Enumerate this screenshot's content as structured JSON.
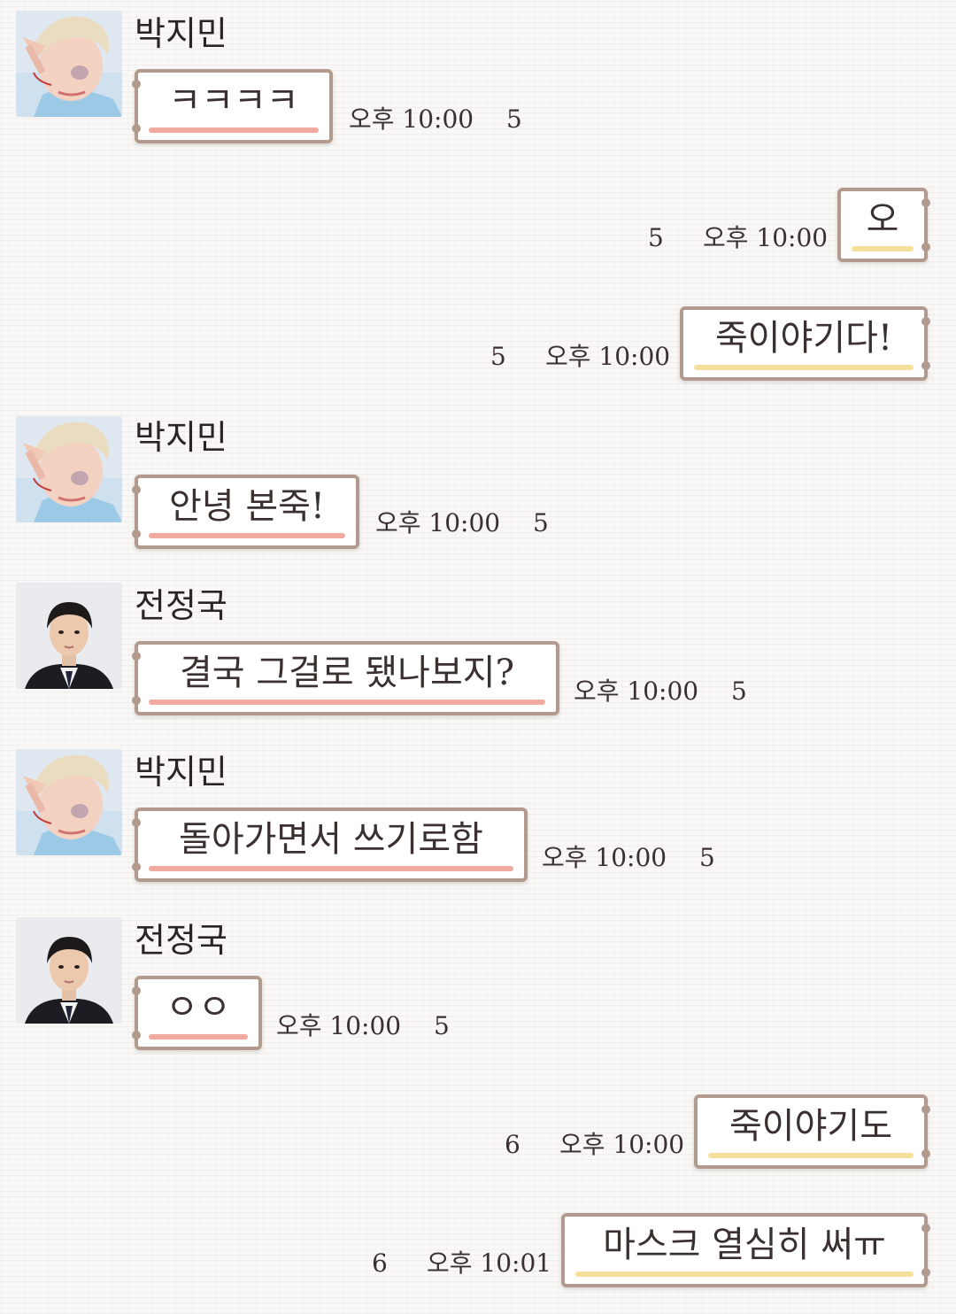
{
  "colors": {
    "bubble_border": "#b39a8e",
    "incoming_underline": "#f0aaa0",
    "outgoing_underline": "#f6df9a",
    "background": "#f9f8f6"
  },
  "senders": {
    "jimin": {
      "name": "박지민",
      "avatar": "jimin-avatar"
    },
    "jungkook": {
      "name": "전정국",
      "avatar": "jungkook-avatar"
    }
  },
  "messages": [
    {
      "direction": "incoming",
      "sender": "박지민",
      "text": "ㅋㅋㅋㅋ",
      "time": "오후 10:00",
      "unread": "5"
    },
    {
      "direction": "outgoing",
      "text": "오",
      "time": "오후 10:00",
      "unread": "5"
    },
    {
      "direction": "outgoing",
      "text": "죽이야기다!",
      "time": "오후 10:00",
      "unread": "5"
    },
    {
      "direction": "incoming",
      "sender": "박지민",
      "text": "안녕 본죽!",
      "time": "오후 10:00",
      "unread": "5"
    },
    {
      "direction": "incoming",
      "sender": "전정국",
      "text": "결국 그걸로 됐나보지?",
      "time": "오후 10:00",
      "unread": "5"
    },
    {
      "direction": "incoming",
      "sender": "박지민",
      "text": "돌아가면서 쓰기로함",
      "time": "오후 10:00",
      "unread": "5"
    },
    {
      "direction": "incoming",
      "sender": "전정국",
      "text": "ㅇㅇ",
      "time": "오후 10:00",
      "unread": "5"
    },
    {
      "direction": "outgoing",
      "text": "죽이야기도",
      "time": "오후 10:00",
      "unread": "6"
    },
    {
      "direction": "outgoing",
      "text": "마스크 열심히 써ㅠ",
      "time": "오후 10:01",
      "unread": "6"
    }
  ]
}
